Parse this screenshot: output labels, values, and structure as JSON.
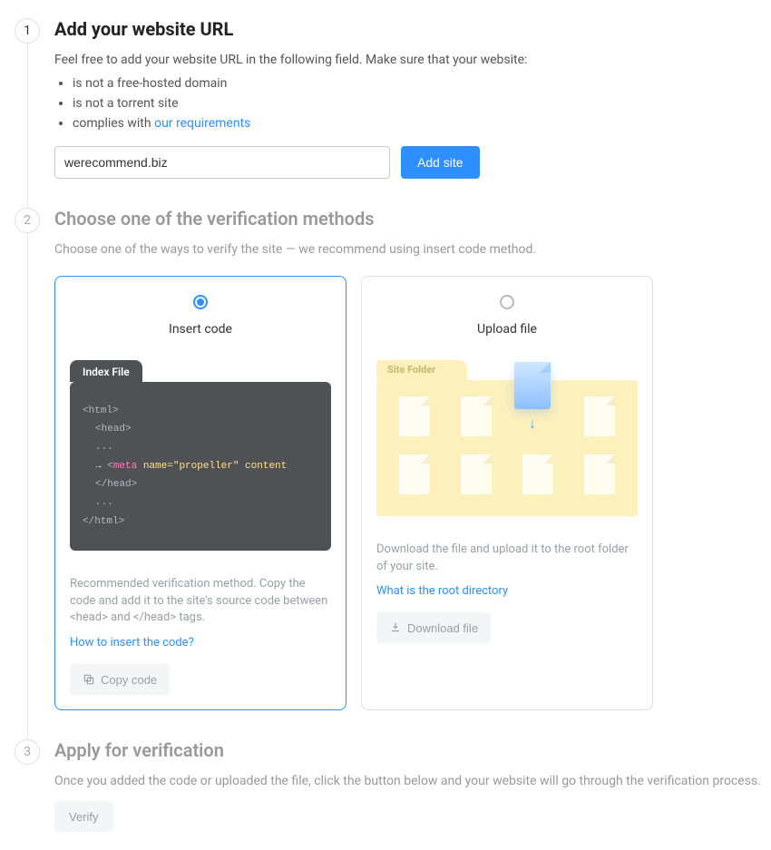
{
  "step1": {
    "number": "1",
    "title": "Add your website URL",
    "intro": "Feel free to add your website URL in the following field. Make sure that your website:",
    "bullets": [
      "is not a free-hosted domain",
      "is not a torrent site",
      "complies with "
    ],
    "requirements_link": "our requirements",
    "input_value": "werecommend.biz",
    "add_button": "Add site"
  },
  "step2": {
    "number": "2",
    "title": "Choose one of the verification methods",
    "intro": "Choose one of the ways to verify the site — we recommend using insert code method.",
    "card_insert": {
      "title": "Insert code",
      "code_tab": "Index File",
      "code_lines": {
        "l1": "<html>",
        "l2": "<head>",
        "l3_dots": "...",
        "l4_arrow": "→",
        "l4_open": "<",
        "l4_meta": "meta",
        "l4_attr": " name=\"propeller\" content",
        "l5": "</head>",
        "l6_dots": "...",
        "l7": "</html>"
      },
      "desc": "Recommended verification method. Copy the code and add it to the site's source code between <head> and </head> tags.",
      "link": "How to insert the code?",
      "button": "Copy code"
    },
    "card_upload": {
      "title": "Upload file",
      "folder_label": "Site Folder",
      "desc": "Download the file and upload it to the root folder of your site.",
      "link": "What is the root directory",
      "button": "Download file"
    }
  },
  "step3": {
    "number": "3",
    "title": "Apply for verification",
    "intro": "Once you added the code or uploaded the file, click the button below and your website will go through the verification process.",
    "button": "Verify"
  }
}
